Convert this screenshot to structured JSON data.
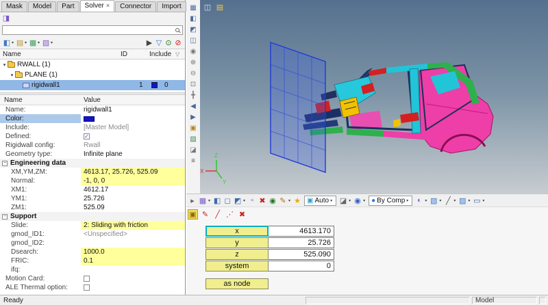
{
  "tabs": [
    {
      "label": "Mask"
    },
    {
      "label": "Model"
    },
    {
      "label": "Part"
    },
    {
      "label": "Solver",
      "active": true
    },
    {
      "label": "Connector"
    },
    {
      "label": "Import"
    }
  ],
  "search": {
    "value": ""
  },
  "panel_toolbar": [
    {
      "name": "entity-editor-icon",
      "glyph": "◨",
      "color": "#7a5ac8"
    }
  ],
  "toolbar2": {
    "left": [
      {
        "name": "create-entity-icon",
        "glyph": "◧",
        "color": "#3a7ac8",
        "arrow": true
      },
      {
        "name": "organize-icon",
        "glyph": "▤",
        "color": "#b8962e",
        "arrow": true
      },
      {
        "name": "card-edit-icon",
        "glyph": "▦",
        "color": "#3f9e5f",
        "arrow": true
      },
      {
        "name": "fe-geometry-icon",
        "glyph": "▧",
        "color": "#8a5ac8",
        "arrow": true
      }
    ],
    "right": [
      {
        "name": "pointer-icon",
        "glyph": "▶",
        "color": "#444"
      },
      {
        "name": "filter-icon",
        "glyph": "▽",
        "color": "#3a7ac8"
      },
      {
        "name": "isolate-icon",
        "glyph": "⊙",
        "color": "#207a20"
      },
      {
        "name": "clear-selection-icon",
        "glyph": "⊘",
        "color": "#cc2020"
      }
    ]
  },
  "tree": {
    "columns": [
      "Name",
      "ID",
      "Include"
    ],
    "items": [
      {
        "label": "RWALL (1)",
        "level": 0,
        "expanded": true,
        "icon": "folder"
      },
      {
        "label": "PLANE (1)",
        "level": 1,
        "expanded": true,
        "icon": "folder"
      },
      {
        "label": "rigidwall1",
        "level": 2,
        "icon": "rigidwall",
        "id": "1",
        "swatch": "#1414c8",
        "include": "0",
        "selected": true
      }
    ]
  },
  "properties": {
    "columns": [
      "Name",
      "Value"
    ],
    "rows": [
      {
        "name": "Name:",
        "value": "rigidwall1"
      },
      {
        "name": "Color:",
        "type": "color",
        "swatch": "#1414c8",
        "selected": true
      },
      {
        "name": "Include:",
        "value": "[Master Model]",
        "dim": true
      },
      {
        "name": "Defined:",
        "type": "checkbox",
        "checked": true
      },
      {
        "name": "Rigidwall config:",
        "value": "Rwall",
        "dim": true
      },
      {
        "name": "Geometry type:",
        "value": "Infinite plane"
      },
      {
        "type": "section",
        "label": "Engineering data"
      },
      {
        "name": "XM,YM,ZM:",
        "value": "4613.17, 25.726, 525.09",
        "highlight": true,
        "indent": true
      },
      {
        "name": "Normal:",
        "value": "-1, 0, 0",
        "highlight": true,
        "indent": true
      },
      {
        "name": "XM1:",
        "value": "4612.17",
        "indent": true
      },
      {
        "name": "YM1:",
        "value": "25.726",
        "indent": true
      },
      {
        "name": "ZM1:",
        "value": "525.09",
        "indent": true
      },
      {
        "type": "section",
        "label": "Support"
      },
      {
        "name": "Slide:",
        "value": "2: Sliding with friction",
        "highlight": true,
        "indent": true
      },
      {
        "name": "gmod_ID1:",
        "value": "<Unspecified>",
        "dim": true,
        "indent": true
      },
      {
        "name": "gmod_ID2:",
        "value": "",
        "indent": true
      },
      {
        "name": "Dsearch:",
        "value": "1000.0",
        "highlight": true,
        "indent": true
      },
      {
        "name": "FRIC:",
        "value": "0.1",
        "highlight": true,
        "indent": true
      },
      {
        "name": "ifq:",
        "value": "",
        "indent": true
      },
      {
        "name": "Motion Card:",
        "type": "checkbox",
        "checked": false
      },
      {
        "name": "ALE Thermal option:",
        "type": "checkbox",
        "checked": false
      }
    ]
  },
  "vstrip": [
    {
      "name": "view-cube-icon",
      "glyph": "▦",
      "color": "#4a6a9a"
    },
    {
      "name": "front-view-icon",
      "glyph": "◧",
      "color": "#4a6a9a"
    },
    {
      "name": "top-view-icon",
      "glyph": "◩",
      "color": "#4a6a9a"
    },
    {
      "name": "iso-view-icon",
      "glyph": "◫",
      "color": "#4a6a9a"
    },
    {
      "name": "rotate-view-icon",
      "glyph": "◉",
      "color": "#777777"
    },
    {
      "name": "zoom-in-icon",
      "glyph": "⊕",
      "color": "#777777"
    },
    {
      "name": "zoom-out-icon",
      "glyph": "⊖",
      "color": "#777777"
    },
    {
      "name": "fit-view-icon",
      "glyph": "⊡",
      "color": "#777777"
    },
    {
      "name": "pan-icon",
      "glyph": "╋",
      "color": "#777777"
    },
    {
      "name": "prev-view-icon",
      "glyph": "◀",
      "color": "#4a6a9a"
    },
    {
      "name": "next-view-icon",
      "glyph": "▶",
      "color": "#4a6a9a"
    },
    {
      "name": "screenshot-icon",
      "glyph": "▣",
      "color": "#b08a20"
    },
    {
      "name": "section-cut-icon",
      "glyph": "▨",
      "color": "#3a8a5a"
    },
    {
      "name": "mask-panel-icon",
      "glyph": "◪",
      "color": "#777777"
    },
    {
      "name": "options-icon",
      "glyph": "≡",
      "color": "#555555"
    }
  ],
  "viewport": {
    "axis": {
      "x": "X",
      "y": "Y",
      "z": "Z"
    },
    "top_icons": [
      {
        "name": "clipping-icon",
        "glyph": "◫",
        "color": "#d7e2f2"
      },
      {
        "name": "legend-icon",
        "glyph": "▤",
        "color": "#f0c84a"
      }
    ]
  },
  "main_toolbar": [
    {
      "name": "pin-left-icon",
      "glyph": "▸",
      "color": "#666666"
    },
    {
      "name": "browser-icon",
      "glyph": "▦",
      "color": "#7a5ac8",
      "arrow": true
    },
    {
      "name": "shaded-view-icon",
      "glyph": "◧",
      "color": "#3a6ab0"
    },
    {
      "name": "wireframe-view-icon",
      "glyph": "◻",
      "color": "#3a6ab0"
    },
    {
      "name": "hidden-line-icon",
      "glyph": "◩",
      "color": "#3a6ab0",
      "arrow": true
    },
    {
      "name": "element-handles-icon",
      "glyph": "▫",
      "color": "#3a6ab0"
    },
    {
      "name": "reject-icon",
      "glyph": "✖",
      "color": "#cc2020"
    },
    {
      "name": "highlight-icon",
      "glyph": "◉",
      "color": "#207a20"
    },
    {
      "name": "quick-edit-icon",
      "glyph": "✎",
      "color": "#b06a20",
      "arrow": true
    },
    {
      "name": "favorites-icon",
      "glyph": "★",
      "color": "#e8a818"
    },
    {
      "name": "selection-mode-combo",
      "glyph": "▣",
      "color": "#30a0d0",
      "label": "Auto"
    },
    {
      "name": "mask-toggle-icon",
      "glyph": "◪",
      "color": "#666666",
      "arrow": true
    },
    {
      "name": "spotlight-icon",
      "glyph": "◉",
      "color": "#3060c0",
      "arrow": true
    },
    {
      "name": "color-by-combo",
      "glyph": "●",
      "color": "#2878d8",
      "label": "By Comp"
    },
    {
      "name": "texture-icon",
      "glyph": "◐",
      "color": "#8868c8",
      "arrow": true
    },
    {
      "name": "solid-shade-icon",
      "glyph": "▧",
      "color": "#3878c8",
      "arrow": true
    },
    {
      "name": "edge-style-icon",
      "glyph": "╱",
      "color": "#555555",
      "arrow": true
    },
    {
      "name": "transparency-icon",
      "glyph": "▨",
      "color": "#3878c8",
      "arrow": true
    },
    {
      "name": "screen-icon",
      "glyph": "▭",
      "color": "#3060a0",
      "arrow": true
    }
  ],
  "tools_row2": [
    {
      "name": "coords-panel-icon",
      "glyph": "▣",
      "color": "#8a6a00",
      "boxed": true
    },
    {
      "name": "pen-icon",
      "glyph": "✎",
      "color": "#cc2020"
    },
    {
      "name": "line-tool-icon",
      "glyph": "╱",
      "color": "#cc2020"
    },
    {
      "name": "dotted-line-icon",
      "glyph": "⋰",
      "color": "#cc2020"
    },
    {
      "name": "close-panel-icon",
      "glyph": "✖",
      "color": "#cc2020"
    }
  ],
  "coord_panel": {
    "rows": [
      {
        "label": "x",
        "value": "4613.170",
        "active": true
      },
      {
        "label": "y",
        "value": "25.726"
      },
      {
        "label": "z",
        "value": "525.090"
      },
      {
        "label": "system",
        "value": "0"
      }
    ],
    "as_node_label": "as node"
  },
  "status": {
    "left": "Ready",
    "model": "Model"
  },
  "colors": {
    "highlight": "#ffff9c",
    "selection": "#8fb8e6",
    "rigidwall_swatch": "#1414c8"
  }
}
